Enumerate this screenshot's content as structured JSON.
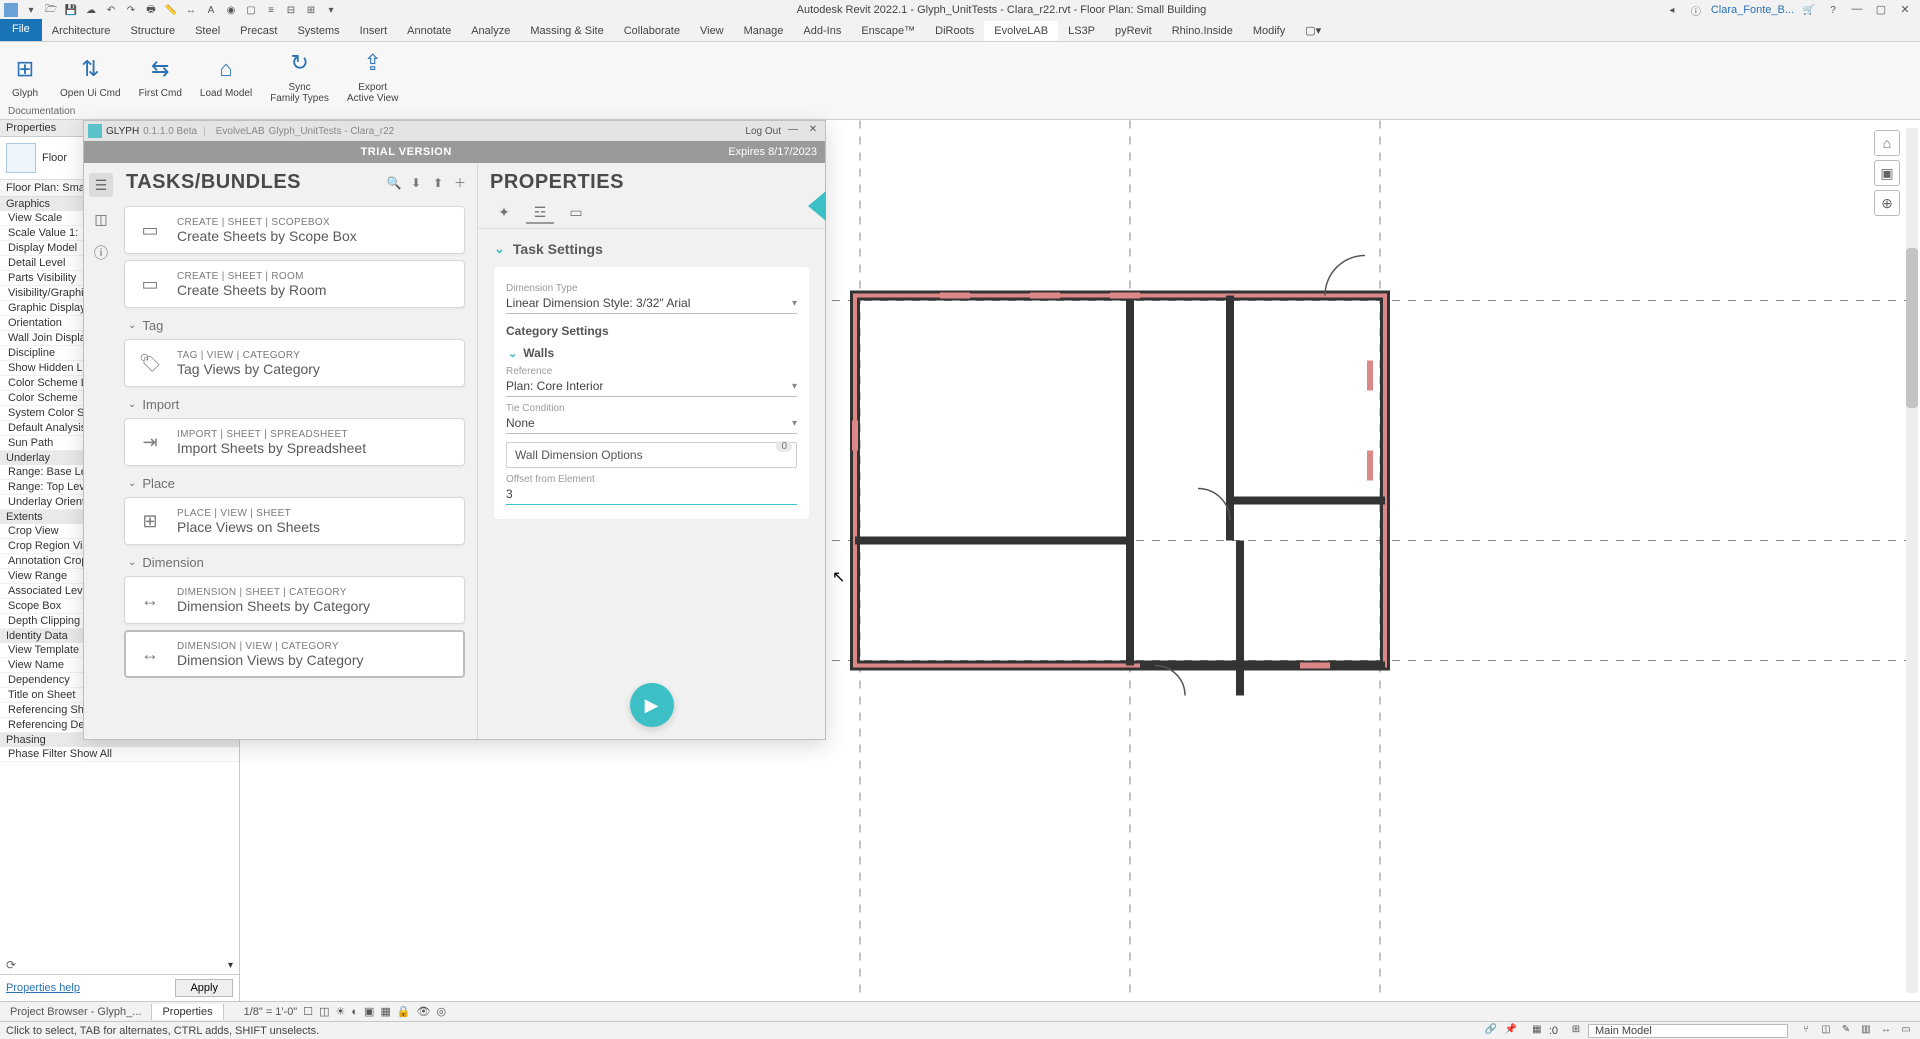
{
  "qat": {
    "title": "Autodesk Revit 2022.1 - Glyph_UnitTests - Clara_r22.rvt - Floor Plan: Small Building",
    "user": "Clara_Fonte_B...",
    "icons": [
      "open",
      "save",
      "undo",
      "redo",
      "print",
      "measure",
      "text",
      "box",
      "align",
      "filter",
      "3d",
      "thin",
      "switch",
      "close-hidden"
    ]
  },
  "tabs": [
    "Architecture",
    "Structure",
    "Steel",
    "Precast",
    "Systems",
    "Insert",
    "Annotate",
    "Analyze",
    "Massing & Site",
    "Collaborate",
    "View",
    "Manage",
    "Add-Ins",
    "Enscape™",
    "DiRoots",
    "EvolveLAB",
    "LS3P",
    "pyRevit",
    "Rhino.Inside",
    "Modify"
  ],
  "active_tab": "EvolveLAB",
  "ribbon": {
    "panel_label": "Documentation",
    "items": [
      {
        "label": "Glyph",
        "icon": "⊞"
      },
      {
        "label": "Open Ui Cmd",
        "icon": "⇅"
      },
      {
        "label": "First Cmd",
        "icon": "⇆"
      },
      {
        "label": "Load Model",
        "icon": "⌂"
      },
      {
        "label": "Sync\nFamily Types",
        "icon": "↻"
      },
      {
        "label": "Export\nActive View",
        "icon": "⇪"
      }
    ]
  },
  "prop_palette": {
    "header": "Properties",
    "type": "Floor",
    "instance": "Floor Plan: Small Bu",
    "sections": [
      {
        "title": "Graphics",
        "rows": [
          "View Scale",
          "Scale Value   1:",
          "Display Model",
          "Detail Level",
          "Parts Visibility",
          "Visibility/Graphics",
          "Graphic Display Op",
          "Orientation",
          "Wall Join Display",
          "Discipline",
          "Show Hidden Line",
          "Color Scheme Loc",
          "Color Scheme",
          "System Color Sche",
          "Default Analysis Di",
          "Sun Path"
        ]
      },
      {
        "title": "Underlay",
        "rows": [
          "Range: Base Level",
          "Range: Top Level",
          "Underlay Orientati"
        ]
      },
      {
        "title": "Extents",
        "rows": [
          "Crop View",
          "Crop Region Visibl",
          "Annotation Crop",
          "View Range",
          "Associated Level",
          "Scope Box",
          "Depth Clipping"
        ]
      },
      {
        "title": "Identity Data",
        "rows": [
          "View Template",
          "View Name",
          "Dependency",
          "Title on Sheet",
          "Referencing Sheet",
          "Referencing Detail"
        ]
      },
      {
        "title": "Phasing",
        "rows": [
          "Phase Filter    Show All"
        ]
      }
    ],
    "help": "Properties help",
    "apply": "Apply"
  },
  "glyph": {
    "title_name": "GLYPH",
    "title_ver": "0.1.1.0 Beta",
    "title_owner": "EvolveLAB",
    "title_doc": "Glyph_UnitTests - Clara_r22",
    "logout": "Log Out",
    "trial": "TRIAL VERSION",
    "expires": "Expires 8/17/2023",
    "tasks_header": "TASKS/BUNDLES",
    "groups": [
      {
        "label": "",
        "cards": [
          {
            "bc": "CREATE  |  SHEET  |  SCOPEBOX",
            "name": "Create Sheets by Scope Box",
            "icon": "▭"
          },
          {
            "bc": "CREATE  |  SHEET  |  ROOM",
            "name": "Create Sheets by Room",
            "icon": "▭"
          }
        ]
      },
      {
        "label": "Tag",
        "cards": [
          {
            "bc": "TAG  |  VIEW  |  CATEGORY",
            "name": "Tag Views by Category",
            "icon": "🏷"
          }
        ]
      },
      {
        "label": "Import",
        "cards": [
          {
            "bc": "IMPORT  |  SHEET  |  SPREADSHEET",
            "name": "Import Sheets by Spreadsheet",
            "icon": "⇥"
          }
        ]
      },
      {
        "label": "Place",
        "cards": [
          {
            "bc": "PLACE  |  VIEW  |  SHEET",
            "name": "Place Views on Sheets",
            "icon": "⊞"
          }
        ]
      },
      {
        "label": "Dimension",
        "cards": [
          {
            "bc": "DIMENSION  |  SHEET  |  CATEGORY",
            "name": "Dimension Sheets by Category",
            "icon": "↔"
          },
          {
            "bc": "DIMENSION  |  VIEW  |  CATEGORY",
            "name": "Dimension Views by Category",
            "icon": "↔",
            "selected": true
          }
        ]
      }
    ],
    "props_header": "PROPERTIES",
    "task_settings_title": "Task Settings",
    "fields": {
      "dim_type_label": "Dimension Type",
      "dim_type_value": "Linear Dimension Style: 3/32\" Arial",
      "cat_settings": "Category Settings",
      "walls": "Walls",
      "ref_label": "Reference",
      "ref_value": "Plan: Core Interior",
      "tie_label": "Tie Condition",
      "tie_value": "None",
      "wall_dim_opt": "Wall Dimension Options",
      "wall_dim_badge": "0",
      "offset_label": "Offset from Element",
      "offset_value": "3"
    }
  },
  "viewbar": {
    "scale": "1/8\" = 1'-0\""
  },
  "doc_tabs": [
    "Project Browser - Glyph_...",
    "Properties"
  ],
  "status": {
    "hint": "Click to select, TAB for alternates, CTRL adds, SHIFT unselects.",
    "sel": ":0",
    "model": "Main Model"
  }
}
